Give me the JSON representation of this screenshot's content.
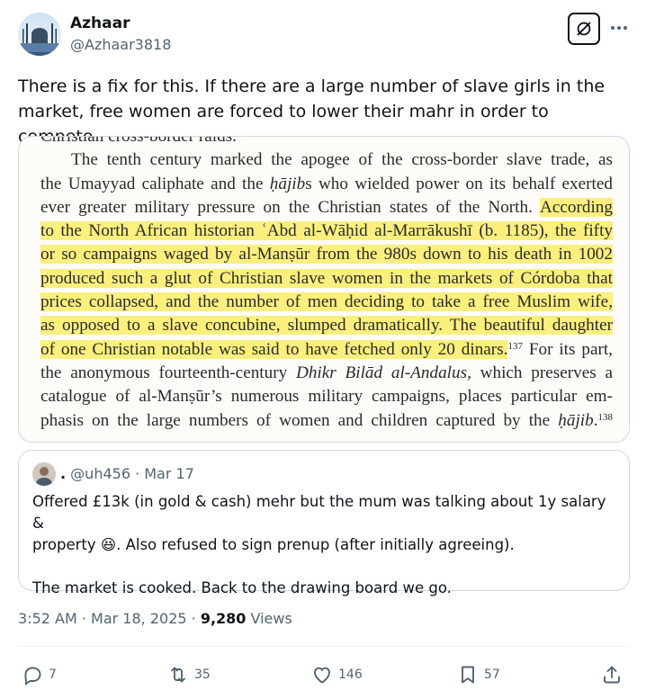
{
  "author": {
    "name": "Azhaar",
    "handle": "@Azhaar3818"
  },
  "tweet": {
    "text": "There is a fix for this. If there are a large number of slave girls in the market, free women are forced to lower their mahr in order to compete."
  },
  "book_excerpt": {
    "line_0": "Christian cross-border raids.",
    "line_1": "The tenth century marked the apogee of the cross-border slave trade, as",
    "line_2_a": "the Umayyad caliphate and the ",
    "line_2_i": "ḥājib",
    "line_2_b": "s who wielded power on its behalf exerted",
    "line_3_a": "ever greater military pressure on the Christian states of the North. ",
    "line_3_hl": "According",
    "line_4_hl": "to the North African historian ʿAbd al-Wāḥid al-Marrākushī (b. 1185), the fifty",
    "line_5_hl": "or so campaigns waged by al-Manṣūr from the 980s down to his death in 1002",
    "line_6_hl": "produced such a glut of Christian slave women in the markets of Córdoba that",
    "line_7_hl": "prices collapsed, and the number of men deciding to take a free Muslim wife,",
    "line_8_hl": "as opposed to a slave concubine, slumped dramatically. The beautiful daughter",
    "line_9_hl": "of one Christian notable was said to have fetched only 20 dinars.",
    "line_9_sup": "137",
    "line_9_b": " For its part,",
    "line_10_a": "the anonymous fourteenth-century ",
    "line_10_i": "Dhikr Bilād al-Andalus",
    "line_10_b": ", which preserves a",
    "line_11": "catalogue of al-Manṣūr’s numerous military campaigns, places particular em-",
    "line_12_a": "phasis on the large numbers of women and children captured by the ",
    "line_12_i": "ḥājib",
    "line_12_b": ".",
    "line_12_sup": "138"
  },
  "quoted_tweet": {
    "display_name": ".",
    "handle_date": "@uh456 · Mar 17",
    "line_1": "Offered £13k (in gold & cash) mehr but the mum was talking about 1y salary &",
    "line_2_a": "property ",
    "emoji": "😆",
    "line_2_b": ". Also refused to sign prenup (after initially agreeing).",
    "line_3": "The market is cooked. Back to the drawing board we go."
  },
  "meta": {
    "timestamp": "3:52 AM · Mar 18, 2025 · ",
    "views_count": "9,280",
    "views_label": " Views"
  },
  "actions": {
    "replies": "7",
    "reposts": "35",
    "likes": "146",
    "bookmarks": "57"
  },
  "icons": [
    "grok-icon",
    "more-icon",
    "reply-icon",
    "repost-icon",
    "like-icon",
    "bookmark-icon",
    "share-icon"
  ],
  "colors": {
    "highlight": "#fbef7e",
    "secondary_text": "#536471",
    "primary_text": "#0f1419",
    "border": "#cfd9de"
  }
}
